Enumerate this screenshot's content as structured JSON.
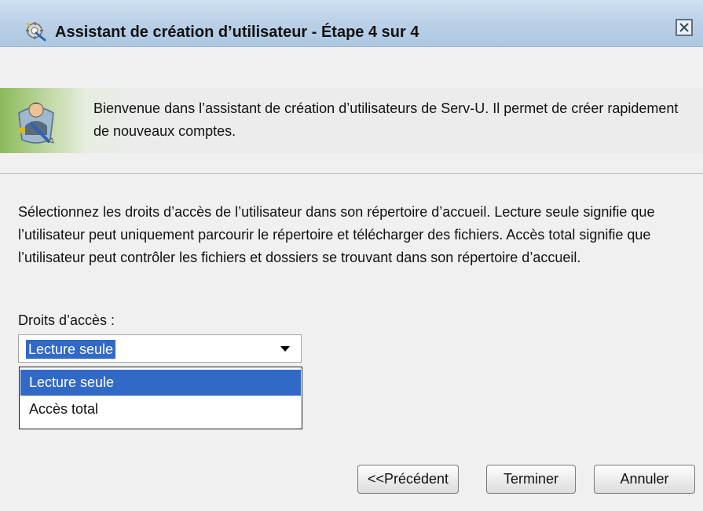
{
  "window": {
    "title": "Assistant de création d’utilisateur - Étape 4 sur 4",
    "title_icon": "wizard-icon",
    "close_icon": "close-icon"
  },
  "banner": {
    "icon": "user-wizard-icon",
    "text": "Bienvenue dans l’assistant de création d’utilisateurs de Serv-U. Il permet de créer rapidement de nouveaux comptes."
  },
  "main": {
    "description": "Sélectionnez les droits d’accès de l’utilisateur dans son répertoire d’accueil. Lecture seule signifie que l’utilisateur peut uniquement parcourir le répertoire et télécharger des fichiers. Accès total signifie que l’utilisateur peut contrôler les fichiers et dossiers se trouvant dans son répertoire d’accueil.",
    "access_label": "Droits d’accès :",
    "access_select": {
      "value": "Lecture seule",
      "options": [
        "Lecture seule",
        "Accès total"
      ],
      "highlighted_option": "Lecture seule"
    }
  },
  "buttons": {
    "previous": "<<Précédent",
    "finish": "Terminer",
    "cancel": "Annuler"
  },
  "colors": {
    "selection": "#3169c6",
    "title_bar": "#b9cfe6",
    "banner_accent": "#8cba5a"
  }
}
